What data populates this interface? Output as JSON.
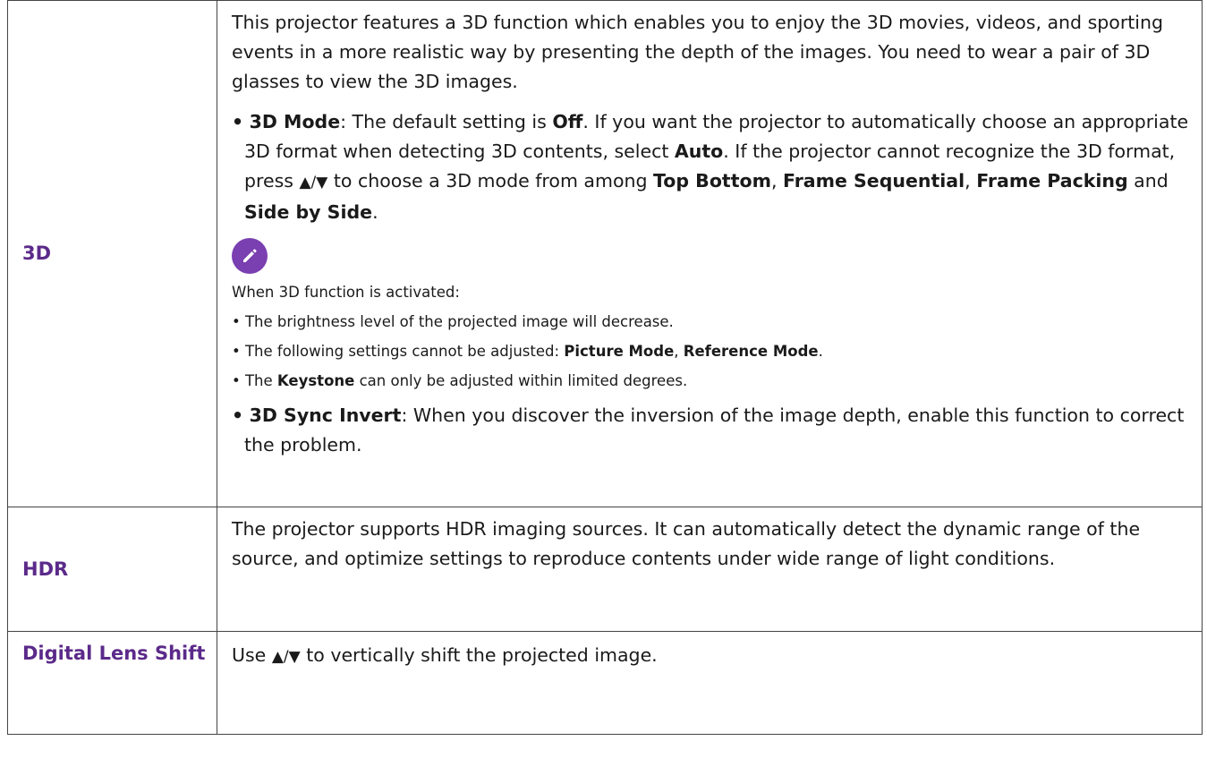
{
  "rows": {
    "three_d": {
      "label": "3D",
      "intro": "This projector features a 3D function which enables you to enjoy the 3D movies, videos, and sporting events in a more realistic way by presenting the depth of the images. You need to wear a pair of 3D glasses to view the 3D images.",
      "mode": {
        "bullet": "•",
        "title": "3D Mode",
        "t1": ": The default setting is ",
        "off": "Off",
        "t2": ". If you want the projector to automatically choose an appropriate 3D format when detecting 3D contents, select ",
        "auto": "Auto",
        "t3": ". If the projector cannot recognize the 3D format, press ",
        "arrows": "▲/▼",
        "t4": " to choose a 3D mode from among ",
        "opt1": "Top Bottom",
        "sep1": ", ",
        "opt2": "Frame Sequential",
        "sep2": ", ",
        "opt3": "Frame Packing",
        "sep3": " and ",
        "opt4": "Side by Side",
        "end": "."
      },
      "note": {
        "icon": "pencil-icon",
        "heading": "When 3D function is activated:",
        "b1": "• The brightness level of the projected image will decrease.",
        "b2_prefix": "•  The following settings cannot be adjusted: ",
        "b2_bold1": "Picture Mode",
        "b2_sep": ", ",
        "b2_bold2": "Reference Mode",
        "b2_end": ".",
        "b3_prefix": "• The ",
        "b3_bold": "Keystone",
        "b3_end": " can only be adjusted within limited degrees."
      },
      "sync": {
        "bullet": "•",
        "title": "3D Sync Invert",
        "text": ": When you discover the inversion of the image depth, enable this function to correct the problem."
      }
    },
    "hdr": {
      "label": "HDR",
      "text": "The projector supports HDR imaging sources. It can automatically detect the dynamic range of the source, and optimize settings to reproduce contents under wide range of light conditions."
    },
    "lens_shift": {
      "label": "Digital Lens Shift",
      "t1": "Use ",
      "arrows": "▲/▼",
      "t2": " to vertically shift the projected image."
    }
  },
  "colors": {
    "label": "#5b2a8a",
    "icon": "#7a3fb0",
    "border": "#444444"
  }
}
